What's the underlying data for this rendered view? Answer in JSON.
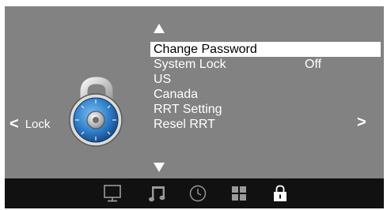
{
  "left_nav": {
    "chevron": "<",
    "label": "Lock"
  },
  "right_nav": {
    "chevron": ">"
  },
  "menu": {
    "items": [
      {
        "label": "Change Password",
        "value": "",
        "selected": true
      },
      {
        "label": "System Lock",
        "value": "Off",
        "selected": false
      },
      {
        "label": "US",
        "value": "",
        "selected": false
      },
      {
        "label": "Canada",
        "value": "",
        "selected": false
      },
      {
        "label": "RRT Setting",
        "value": "",
        "selected": false
      },
      {
        "label": "Resel RRT",
        "value": "",
        "selected": false
      }
    ]
  },
  "tabs": [
    {
      "icon": "monitor-icon",
      "active": false
    },
    {
      "icon": "music-note-icon",
      "active": false
    },
    {
      "icon": "clock-icon",
      "active": false
    },
    {
      "icon": "grid-icon",
      "active": false
    },
    {
      "icon": "lock-icon",
      "active": true
    }
  ],
  "colors": {
    "background": "#828282",
    "tabbar": "#111111",
    "text": "#ffffff",
    "selected_bg": "#ffffff",
    "selected_text": "#000000",
    "inactive_icon": "#9a9a9a",
    "active_icon": "#ffffff",
    "lock_dial": "#2f7fc9"
  }
}
